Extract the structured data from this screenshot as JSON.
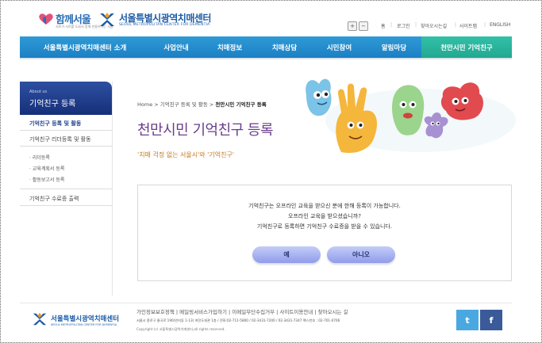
{
  "header": {
    "seoul_logo": "함께서울",
    "seoul_logo_sub": "서로가 서로를 도와서 함께 만들어가는 서울",
    "center_name": "서울특별시광역치매센터",
    "center_name_en": "SEOUL METROPOLITAN CENTER FOR DEMENTIA",
    "zoom_in": "+",
    "zoom_out": "−",
    "util_links": [
      "홈",
      "로그인",
      "찾아오시는길",
      "사이트맵",
      "ENGLISH"
    ]
  },
  "nav": {
    "items": [
      "서울특별시광역치매센터 소개",
      "사업안내",
      "치매정보",
      "치매상담",
      "시민참여",
      "알림마당",
      "천만시민 기억친구"
    ],
    "active_index": 6
  },
  "side": {
    "about": "About us",
    "title": "기억친구 등록",
    "items": [
      "기억친구 등록 및 활동",
      "기억친구 리더등록 및 활동"
    ],
    "subitems": [
      "리더등록",
      "교육계획서 등록",
      "활동보고서 등록"
    ],
    "last_item": "기억친구 수료증 출력"
  },
  "main": {
    "breadcrumb": "Home > 기억친구 등록 및 활동 >",
    "breadcrumb_current": "천만시민 기억친구 등록",
    "title": "천만시민 기억친구 등록",
    "subtitle": "'치매 걱정 없는 서울시'와 '기억친구'"
  },
  "dialog": {
    "lines": [
      "기억친구는 오프라인 교육을 받으신 분에 한해 등록이 가능합니다.",
      "오프라인 교육을 받으셨습니까?",
      "기억친구로 등록하면 기억친구 수료증을 받을 수 있습니다."
    ],
    "yes_label": "예",
    "no_label": "아니오"
  },
  "footer": {
    "name": "서울특별시광역치매센터",
    "name_en": "SEOUL METROPOLITAN CENTER FOR DEMENTIA",
    "links": "가인정보보호정책  |  메일링서비스가입하기  |  이메일무단수집거부  |  사이트이용안내  |  찾아오시는 길",
    "address": "서울시 종로구 율곡로 190(연지동 1-13) 여전도회관 1층 / 전화:02-711-5800 / 02-3431-7200 / 02-3431-7347 팩스번호 : 02-701-0706",
    "copyright": "Copyright (c) 서울특별시광역치매센터,all rights reserved.",
    "twitter": "t",
    "facebook": "f"
  },
  "colors": {
    "nav": "#1b80c4",
    "nav_active": "#22a891",
    "title": "#6a3d8f",
    "subtitle": "#c47a1a",
    "button": "#8f9ceb",
    "twitter": "#4aa8e0",
    "facebook": "#3b5a9a"
  }
}
